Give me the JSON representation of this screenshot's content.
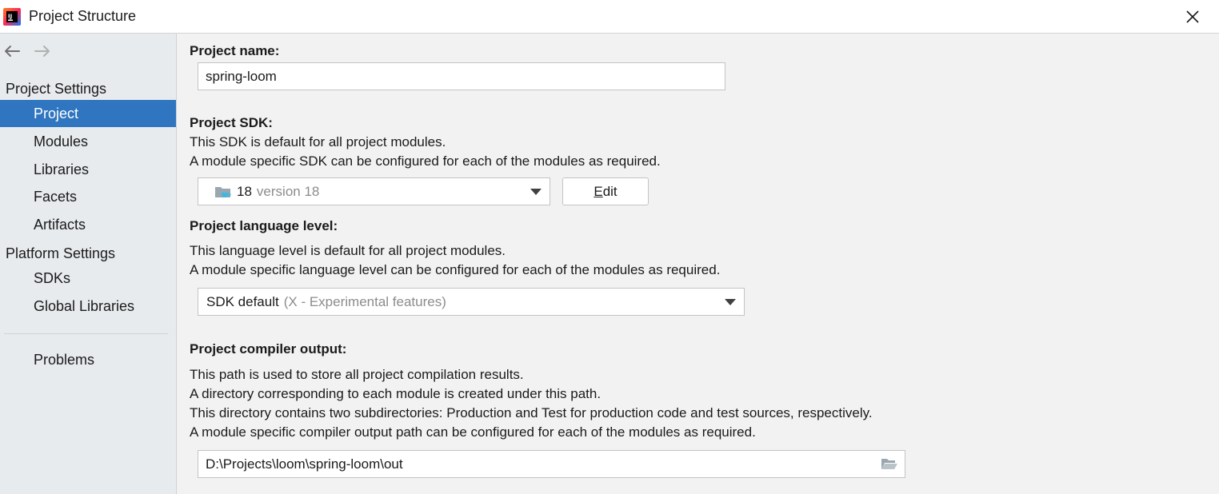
{
  "window": {
    "title": "Project Structure"
  },
  "sidebar": {
    "groups": [
      {
        "header": "Project Settings",
        "items": [
          "Project",
          "Modules",
          "Libraries",
          "Facets",
          "Artifacts"
        ]
      },
      {
        "header": "Platform Settings",
        "items": [
          "SDKs",
          "Global Libraries"
        ]
      }
    ],
    "extra": [
      "Problems"
    ],
    "selected": "Project"
  },
  "main": {
    "project_name": {
      "label": "Project name:",
      "value": "spring-loom"
    },
    "sdk": {
      "label": "Project SDK:",
      "desc1": "This SDK is default for all project modules.",
      "desc2": "A module specific SDK can be configured for each of the modules as required.",
      "selected_name": "18",
      "selected_detail": "version 18",
      "edit_mnemonic": "E",
      "edit_rest": "dit"
    },
    "language_level": {
      "label": "Project language level:",
      "desc1": "This language level is default for all project modules.",
      "desc2": "A module specific language level can be configured for each of the modules as required.",
      "selected_name": "SDK default",
      "selected_detail": "(X - Experimental features)"
    },
    "compiler_output": {
      "label": "Project compiler output:",
      "desc1": "This path is used to store all project compilation results.",
      "desc2": "A directory corresponding to each module is created under this path.",
      "desc3": "This directory contains two subdirectories: Production and Test for production code and test sources, respectively.",
      "desc4": "A module specific compiler output path can be configured for each of the modules as required.",
      "path": "D:\\Projects\\loom\\spring-loom\\out"
    }
  },
  "icons": {
    "app": "intellij-idea-icon",
    "close": "close-icon",
    "back": "arrow-left-icon",
    "forward": "arrow-right-icon",
    "sdk": "java-sdk-folder-icon",
    "dropdown": "chevron-down-icon",
    "browse": "folder-open-icon"
  },
  "colors": {
    "selection": "#2f75c0",
    "sidebar_bg": "#e8ebee",
    "content_bg": "#f2f2f2"
  }
}
